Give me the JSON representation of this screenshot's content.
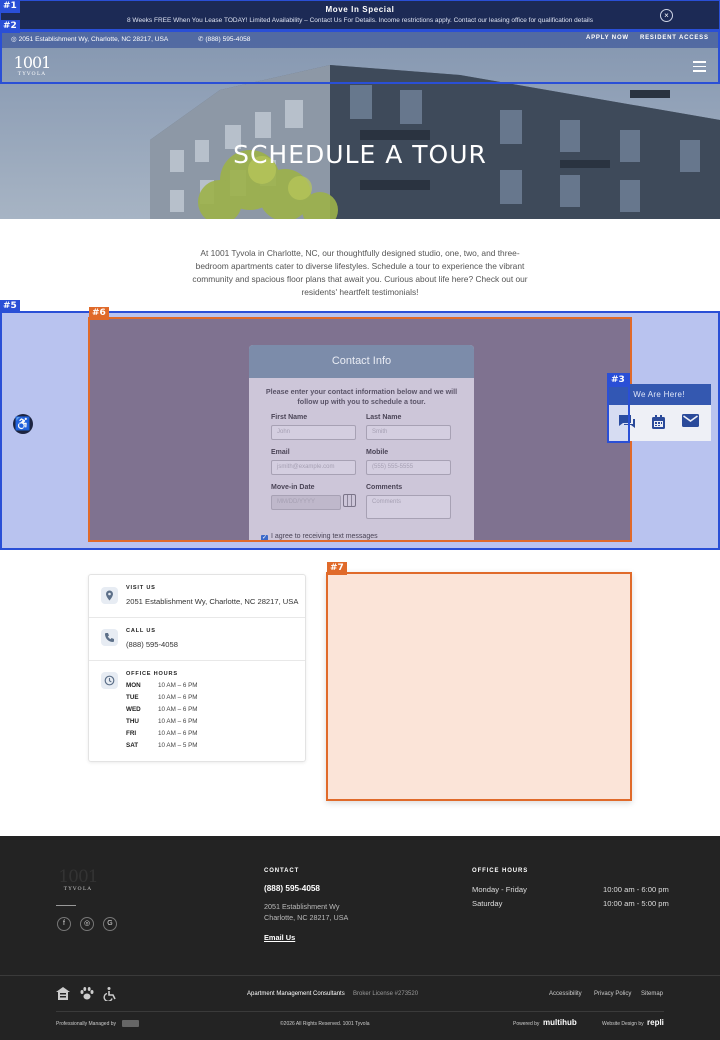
{
  "promo": {
    "title": "Move In Special",
    "text": "8 Weeks FREE When You Lease TODAY! Limited Availability – Contact Us For Details. Income restrictions apply. Contact our leasing office for qualification details",
    "close_icon": "×"
  },
  "infobar": {
    "address": "2051 Establishment Wy, Charlotte, NC 28217, USA",
    "phone": "(888) 595-4058",
    "apply": "APPLY NOW",
    "resident": "RESIDENT ACCESS"
  },
  "logo": {
    "number": "1001",
    "name": "TYVOLA"
  },
  "hero": {
    "title": "SCHEDULE A TOUR"
  },
  "intro": "At 1001 Tyvola in Charlotte, NC, our thoughtfully designed studio, one, two, and three-bedroom apartments cater to diverse lifestyles. Schedule a tour to experience the vibrant community and spacious floor plans that await you. Curious about life here? Check out our residents' heartfelt testimonials!",
  "form": {
    "header": "Contact Info",
    "subtitle": "Please enter your contact information below and we will follow up with you to schedule a tour.",
    "first_name_label": "First Name",
    "first_name_placeholder": "John",
    "last_name_label": "Last Name",
    "last_name_placeholder": "Smith",
    "email_label": "Email",
    "email_placeholder": "jsmith@example.com",
    "mobile_label": "Mobile",
    "mobile_placeholder": "(555) 555-5555",
    "movein_label": "Move-in Date",
    "movein_placeholder": "MM/DD/YYYY",
    "comments_label": "Comments",
    "comments_placeholder": "Comments",
    "checkbox_label": "I agree to receiving text messages"
  },
  "widget": {
    "title": "We Are Here!",
    "icons": [
      "chat-icon",
      "calendar-icon",
      "mail-icon"
    ]
  },
  "overlay_tags": [
    "#1",
    "#2",
    "#3",
    "#5",
    "#6",
    "#7"
  ],
  "contact": {
    "visit_heading": "VISIT US",
    "visit_value": "2051 Establishment Wy, Charlotte, NC 28217, USA",
    "call_heading": "CALL US",
    "call_value": "(888) 595-4058",
    "hours_heading": "OFFICE HOURS",
    "hours": [
      {
        "day": "MON",
        "time": "10 AM – 6 PM"
      },
      {
        "day": "TUE",
        "time": "10 AM – 6 PM"
      },
      {
        "day": "WED",
        "time": "10 AM – 6 PM"
      },
      {
        "day": "THU",
        "time": "10 AM – 6 PM"
      },
      {
        "day": "FRI",
        "time": "10 AM – 6 PM"
      },
      {
        "day": "SAT",
        "time": "10 AM – 5 PM"
      }
    ]
  },
  "footer": {
    "contact_heading": "CONTACT",
    "phone": "(888) 595-4058",
    "address_line1": "2051 Establishment Wy",
    "address_line2": "Charlotte, NC 28217, USA",
    "email_link": "Email Us",
    "hours_heading": "OFFICE HOURS",
    "weekday_label": "Monday - Friday",
    "weekday_hours": "10:00 am - 6:00 pm",
    "saturday_label": "Saturday",
    "saturday_hours": "10:00 am - 5:00 pm",
    "management": "Apartment Management Consultants",
    "broker": "Broker License #273520",
    "accessibility": "Accessibility",
    "privacy": "Privacy Policy",
    "sitemap": "Sitemap",
    "managed_by": "Professionally Managed by",
    "copyright": "©2026 All Rights Reserved. 1001 Tyvola",
    "powered_by": "Powered by",
    "powered_brand": "multihub",
    "design_by": "Website Design by",
    "design_brand": "repli"
  }
}
